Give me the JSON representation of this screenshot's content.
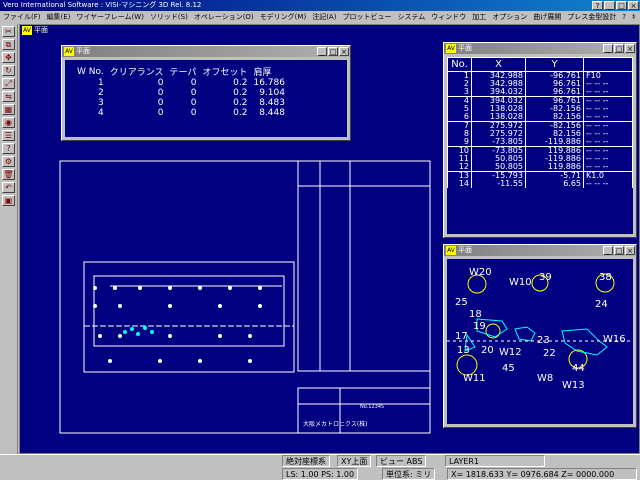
{
  "app_title": "Vero International Software : VISI-マシニング 3D Rel. 8.12",
  "title_buttons": [
    "?",
    "_",
    "□",
    "×"
  ],
  "menu": [
    "ファイル(F)",
    "編集(E)",
    "ワイヤーフレーム(W)",
    "ソリッド(S)",
    "オペレーション(O)",
    "モデリング(M)",
    "注記(A)",
    "プロットビュー",
    "システム",
    "ウィンドウ",
    "加工",
    "オプション",
    "曲げ展開",
    "プレス金型設計",
    "?",
    "ｷ"
  ],
  "toolbar_icons": [
    "trim-icon",
    "copy-icon",
    "move-icon",
    "rotate-icon",
    "scale-icon",
    "mirror-icon",
    "array-icon",
    "view-icon",
    "layer-icon",
    "measure-icon",
    "settings-icon",
    "delete-icon",
    "undo-icon",
    "export-icon"
  ],
  "main_window": {
    "title": "平面"
  },
  "tools_window": {
    "title": "平面",
    "headers": [
      "W No.",
      "クリアランス",
      "テーパ",
      "オフセット",
      "肩厚"
    ],
    "rows": [
      [
        "1",
        "0",
        "0",
        "0.2",
        "16.786"
      ],
      [
        "2",
        "0",
        "0",
        "0.2",
        "9.104"
      ],
      [
        "3",
        "0",
        "0",
        "0.2",
        "8.483"
      ],
      [
        "4",
        "0",
        "0",
        "0.2",
        "8.448"
      ]
    ]
  },
  "coord_window": {
    "title": "平面",
    "headers": [
      "No.",
      "X",
      "Y",
      ""
    ],
    "groups": [
      [
        [
          "1",
          "342.988",
          "-96.761",
          "F10"
        ],
        [
          "2",
          "342.988",
          "96.761",
          "-- -- --"
        ],
        [
          "3",
          "394.032",
          "96.761",
          "-- -- --"
        ]
      ],
      [
        [
          "4",
          "394.032",
          "96.761",
          "-- -- --"
        ],
        [
          "5",
          "138.028",
          "-82.156",
          "-- -- --"
        ],
        [
          "6",
          "138.028",
          "82.156",
          "-- -- --"
        ]
      ],
      [
        [
          "7",
          "275.972",
          "-82.156",
          "-- -- --"
        ],
        [
          "8",
          "275.972",
          "82.156",
          "-- -- --"
        ],
        [
          "9",
          "-73.805",
          "-119.886",
          "-- -- --"
        ]
      ],
      [
        [
          "10",
          "-73.805",
          "119.886",
          "-- -- --"
        ],
        [
          "11",
          "50.805",
          "-119.886",
          "-- -- --"
        ],
        [
          "12",
          "50.805",
          "119.886",
          "-- -- --"
        ]
      ],
      [
        [
          "13",
          "-15.793",
          "-5.71",
          "K1.0"
        ],
        [
          "14",
          "-11.55",
          "6.65",
          "-- -- --"
        ]
      ]
    ]
  },
  "preview_window": {
    "title": "平面",
    "labels": [
      {
        "t": "W20"
      },
      {
        "t": "W10"
      },
      {
        "t": "39"
      },
      {
        "t": "38"
      },
      {
        "t": "25"
      },
      {
        "t": "24"
      },
      {
        "t": "18"
      },
      {
        "t": "19"
      },
      {
        "t": "17"
      },
      {
        "t": "23"
      },
      {
        "t": "W16"
      },
      {
        "t": "13"
      },
      {
        "t": "20"
      },
      {
        "t": "W12"
      },
      {
        "t": "22"
      },
      {
        "t": "W11"
      },
      {
        "t": "45"
      },
      {
        "t": "44"
      },
      {
        "t": "W8"
      },
      {
        "t": "W13"
      }
    ]
  },
  "drawing": {
    "company": "大阪メカトロニクス(株)",
    "drawing_no": "No.12345"
  },
  "status": {
    "coord_system": "絶対座標系",
    "plane": "XY上面",
    "view": "ビュー ABS",
    "layer": "LAYER1",
    "ls": "LS: 1.00 PS: 1.00",
    "unit": "単位系: ミリ",
    "coords": "X= 1818.633 Y= 0976.684 Z= 0000.000"
  }
}
